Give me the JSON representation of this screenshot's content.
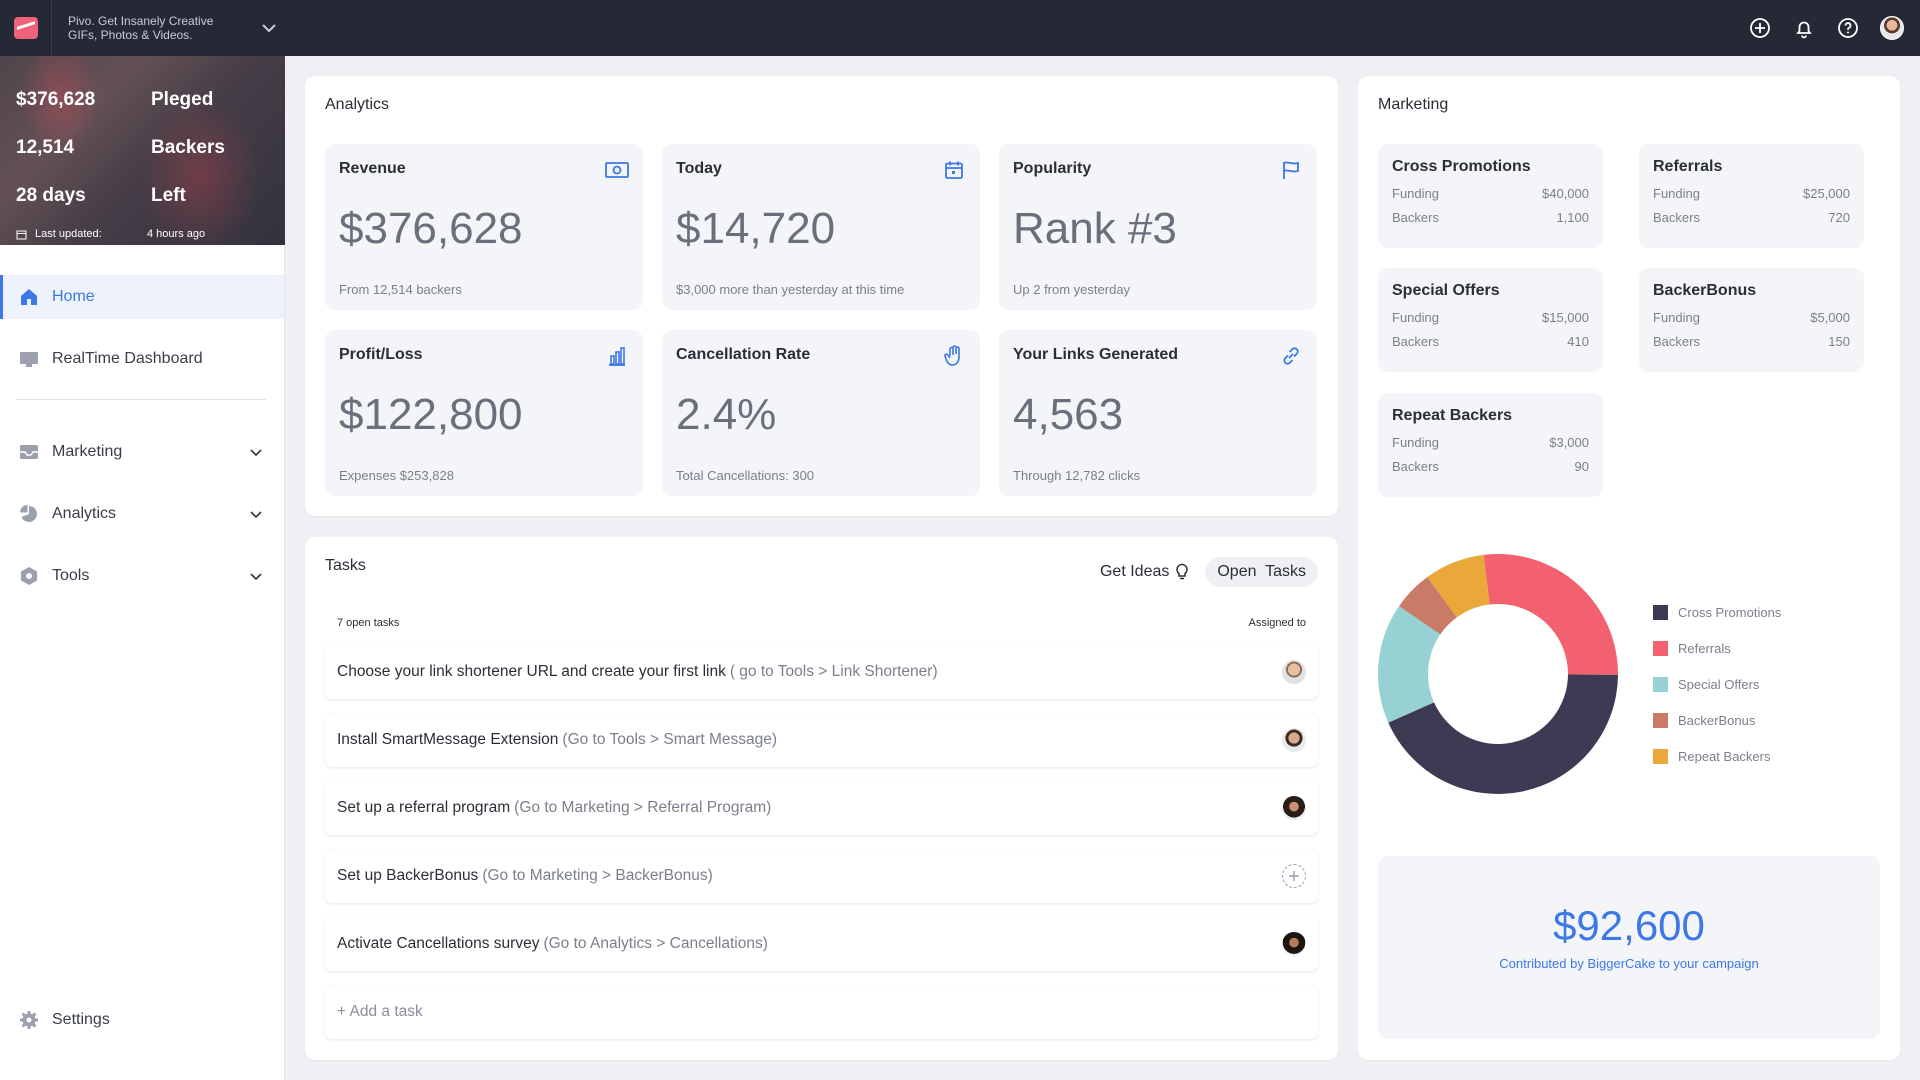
{
  "brand": {
    "line1": "Pivo. Get Insanely Creative",
    "line2": "GIFs, Photos & Videos."
  },
  "campaign": {
    "rows": [
      {
        "value": "$376,628",
        "label": "Pleged"
      },
      {
        "value": "12,514",
        "label": "Backers"
      },
      {
        "value": "28 days",
        "label": "Left"
      }
    ],
    "updated_label": "Last updated:",
    "updated_value": "4 hours ago"
  },
  "nav": {
    "home": "Home",
    "realtime": "RealTime Dashboard",
    "marketing": "Marketing",
    "analytics": "Analytics",
    "tools": "Tools",
    "settings": "Settings"
  },
  "analytics": {
    "title": "Analytics",
    "cards": [
      {
        "title": "Revenue",
        "value": "$376,628",
        "sub": "From 12,514 backers",
        "icon": "money-icon"
      },
      {
        "title": "Today",
        "value": "$14,720",
        "sub": "$3,000 more than yesterday at this time",
        "icon": "calendar-icon"
      },
      {
        "title": "Popularity",
        "value": "Rank #3",
        "sub": "Up 2 from yesterday",
        "icon": "flag-icon"
      },
      {
        "title": "Profit/Loss",
        "value": "$122,800",
        "sub": "Expenses $253,828",
        "icon": "bar-chart-icon"
      },
      {
        "title": "Cancellation Rate",
        "value": "2.4%",
        "sub": "Total Cancellations: 300",
        "icon": "hand-icon"
      },
      {
        "title": "Your Links Generated",
        "value": "4,563",
        "sub": "Through 12,782 clicks",
        "icon": "link-icon"
      }
    ]
  },
  "tasks": {
    "title": "Tasks",
    "get_ideas": "Get Ideas",
    "open_tasks": "Open  Tasks",
    "count_label": "7 open tasks",
    "assigned_label": "Assigned to",
    "items": [
      {
        "text": "Choose your link shortener URL and create your first link",
        "hint": "( go to Tools > Link Shortener)"
      },
      {
        "text": "Install SmartMessage Extension",
        "hint": "(Go to Tools > Smart Message)"
      },
      {
        "text": "Set up a referral program",
        "hint": "(Go to Marketing > Referral Program)"
      },
      {
        "text": "Set up BackerBonus",
        "hint": "(Go to Marketing > BackerBonus)"
      },
      {
        "text": "Activate Cancellations survey",
        "hint": "(Go to Analytics > Cancellations)"
      }
    ],
    "add_task": "+ Add a task"
  },
  "marketing": {
    "title": "Marketing",
    "funding_label": "Funding",
    "backers_label": "Backers",
    "cards": [
      {
        "title": "Cross Promotions",
        "funding": "$40,000",
        "backers": "1,100"
      },
      {
        "title": "Referrals",
        "funding": "$25,000",
        "backers": "720"
      },
      {
        "title": "Special Offers",
        "funding": "$15,000",
        "backers": "410"
      },
      {
        "title": "BackerBonus",
        "funding": "$5,000",
        "backers": "150"
      },
      {
        "title": "Repeat Backers",
        "funding": "$3,000",
        "backers": "90"
      }
    ],
    "bigger": {
      "amount": "$92,600",
      "caption": "Contributed by BiggerCake to your campaign"
    }
  },
  "chart_data": {
    "type": "pie",
    "categories": [
      "Cross Promotions",
      "Referrals",
      "Special Offers",
      "BackerBonus",
      "Repeat Backers"
    ],
    "values": [
      40000,
      25000,
      15000,
      5000,
      7500
    ],
    "colors": [
      "#3d3b54",
      "#f3606f",
      "#96d2d3",
      "#c97b67",
      "#eaa83b"
    ],
    "legend_position": "right"
  }
}
